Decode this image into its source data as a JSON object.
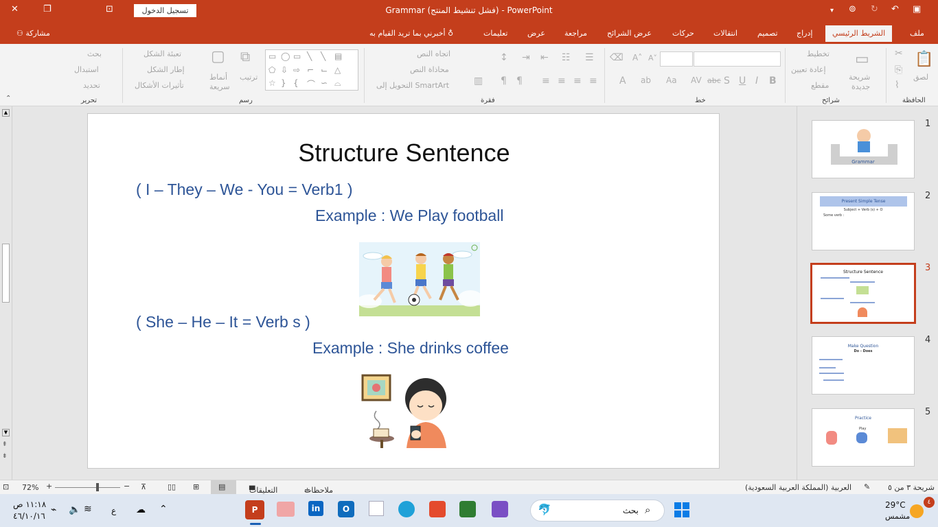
{
  "window": {
    "title": "Grammar (فشل تنشيط المنتج)  -  PowerPoint",
    "signin": "تسجيل الدخول"
  },
  "tabs": [
    {
      "label": "ملف"
    },
    {
      "label": "الشريط الرئيسي",
      "active": true
    },
    {
      "label": "إدراج"
    },
    {
      "label": "تصميم"
    },
    {
      "label": "انتقالات"
    },
    {
      "label": "حركات"
    },
    {
      "label": "عرض الشرائح"
    },
    {
      "label": "مراجعة"
    },
    {
      "label": "عرض"
    },
    {
      "label": "تعليمات"
    },
    {
      "label": "أخبرني بما تريد القيام به"
    }
  ],
  "share": "مشاركة",
  "ribbon": {
    "groups": {
      "clipboard": "الحافظة",
      "slides": "شرائح",
      "font": "خط",
      "paragraph": "فقرة",
      "drawing": "رسم",
      "editing": "تحرير"
    },
    "clipboard": {
      "paste": "لصق"
    },
    "slides": {
      "new_slide_1": "شريحة",
      "new_slide_2": "جديدة",
      "layout": "تخطيط",
      "reset": "إعادة تعيين",
      "section": "مقطع"
    },
    "paragraph": {
      "text_direction": "اتجاه النص",
      "align_text": "محاذاة النص",
      "smartart": "التحويل إلى SmartArt"
    },
    "drawing": {
      "arrange": "ترتيب",
      "styles_1": "أنماط",
      "styles_2": "سريعة",
      "fill": "تعبئة الشكل",
      "outline": "إطار الشكل",
      "effects": "تأثيرات الأشكال"
    },
    "editing": {
      "find": "بحث",
      "replace": "استبدال",
      "select": "تحديد"
    }
  },
  "slide": {
    "title": "Structure Sentence",
    "line1": "( I – They – We - You = Verb1 )",
    "example1": "Example : We Play football",
    "line2": "( She – He – It = Verb s )",
    "example2": "Example : She drinks coffee"
  },
  "thumbnails": [
    {
      "num": "1",
      "title": "Grammar"
    },
    {
      "num": "2",
      "title": "Present Simple Tense",
      "sub": "Subject + Verb (s) + O",
      "note": "Some verb :"
    },
    {
      "num": "3",
      "title": "Structure Sentence",
      "selected": true
    },
    {
      "num": "4",
      "title": "Make Question",
      "sub": "Do - Does"
    },
    {
      "num": "5",
      "title": "Practice",
      "sub": "Play"
    }
  ],
  "status": {
    "slide_count": "شريحة ٣ من ٥",
    "language": "العربية (المملكة العربية السعودية)",
    "notes": "ملاحظات",
    "comments": "التعليقات",
    "zoom": "72%"
  },
  "taskbar": {
    "search": "بحث",
    "temp": "29°C",
    "weather": "مشمس",
    "time": "١١:١٨ ص",
    "date": "٤٦/١٠/١٦",
    "lang": "ع",
    "badge": "٤"
  },
  "colors": {
    "accent": "#c43e1c",
    "text_blue": "#2e5597"
  }
}
